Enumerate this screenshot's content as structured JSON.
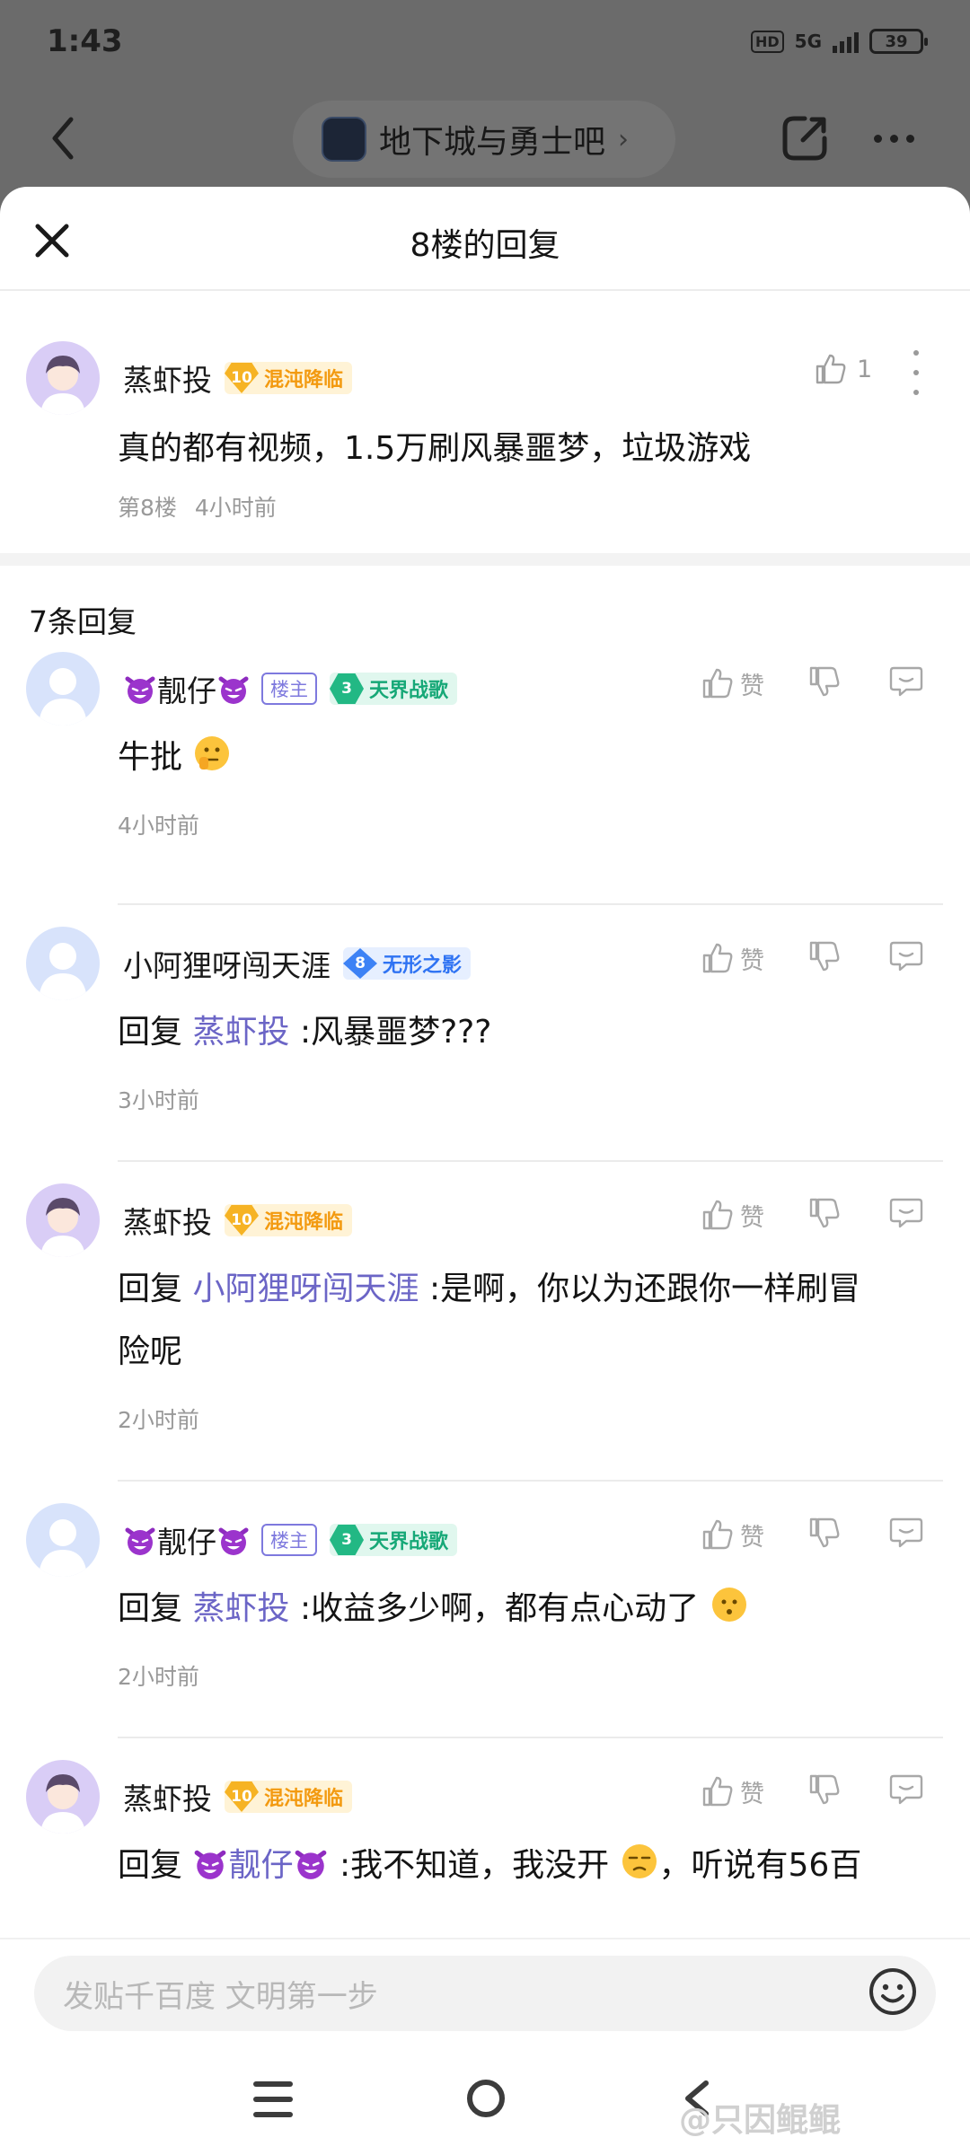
{
  "status": {
    "time": "1:43",
    "hd": "HD",
    "network": "5G",
    "battery": "39"
  },
  "nav": {
    "forum_name": "地下城与勇士吧"
  },
  "sheet": {
    "title": "8楼的回复"
  },
  "main_post": {
    "username": "蒸虾投",
    "level": "10",
    "level_title": "混沌降临",
    "like_count": "1",
    "text": "真的都有视频，1.5万刷风暴噩梦，垃圾游戏",
    "floor": "第8楼",
    "time": "4小时前"
  },
  "reply_count_label": "7条回复",
  "labels": {
    "like": "赞",
    "louzhu": "楼主",
    "reply_prefix": "回复"
  },
  "replies": [
    {
      "username": "靓仔",
      "level": "3",
      "level_title": "天界战歌",
      "is_op": true,
      "text": "牛批",
      "time": "4小时前"
    },
    {
      "username": "小阿狸呀闯天涯",
      "level": "8",
      "level_title": "无形之影",
      "mention": "蒸虾投",
      "text": ":风暴噩梦???",
      "time": "3小时前"
    },
    {
      "username": "蒸虾投",
      "level": "10",
      "level_title": "混沌降临",
      "mention": "小阿狸呀闯天涯",
      "text_line1": ":是啊，你以为还跟你一样刷冒",
      "text_line2": "险呢",
      "time": "2小时前"
    },
    {
      "username": "靓仔",
      "level": "3",
      "level_title": "天界战歌",
      "is_op": true,
      "mention": "蒸虾投",
      "text": ":收益多少啊，都有点心动了",
      "time": "2小时前"
    },
    {
      "username": "蒸虾投",
      "level": "10",
      "level_title": "混沌降临",
      "mention": "靓仔",
      "text_a": ":我不知道，我没开",
      "text_b": "，听说有56百"
    }
  ],
  "input": {
    "placeholder": "发贴千百度 文明第一步"
  },
  "watermark": "@只因鲲鲲",
  "colors": {
    "mention": "#6b65c6",
    "gold": "#f39a10",
    "green": "#16a877",
    "blue": "#2f73f3",
    "gray_text": "#999999"
  }
}
